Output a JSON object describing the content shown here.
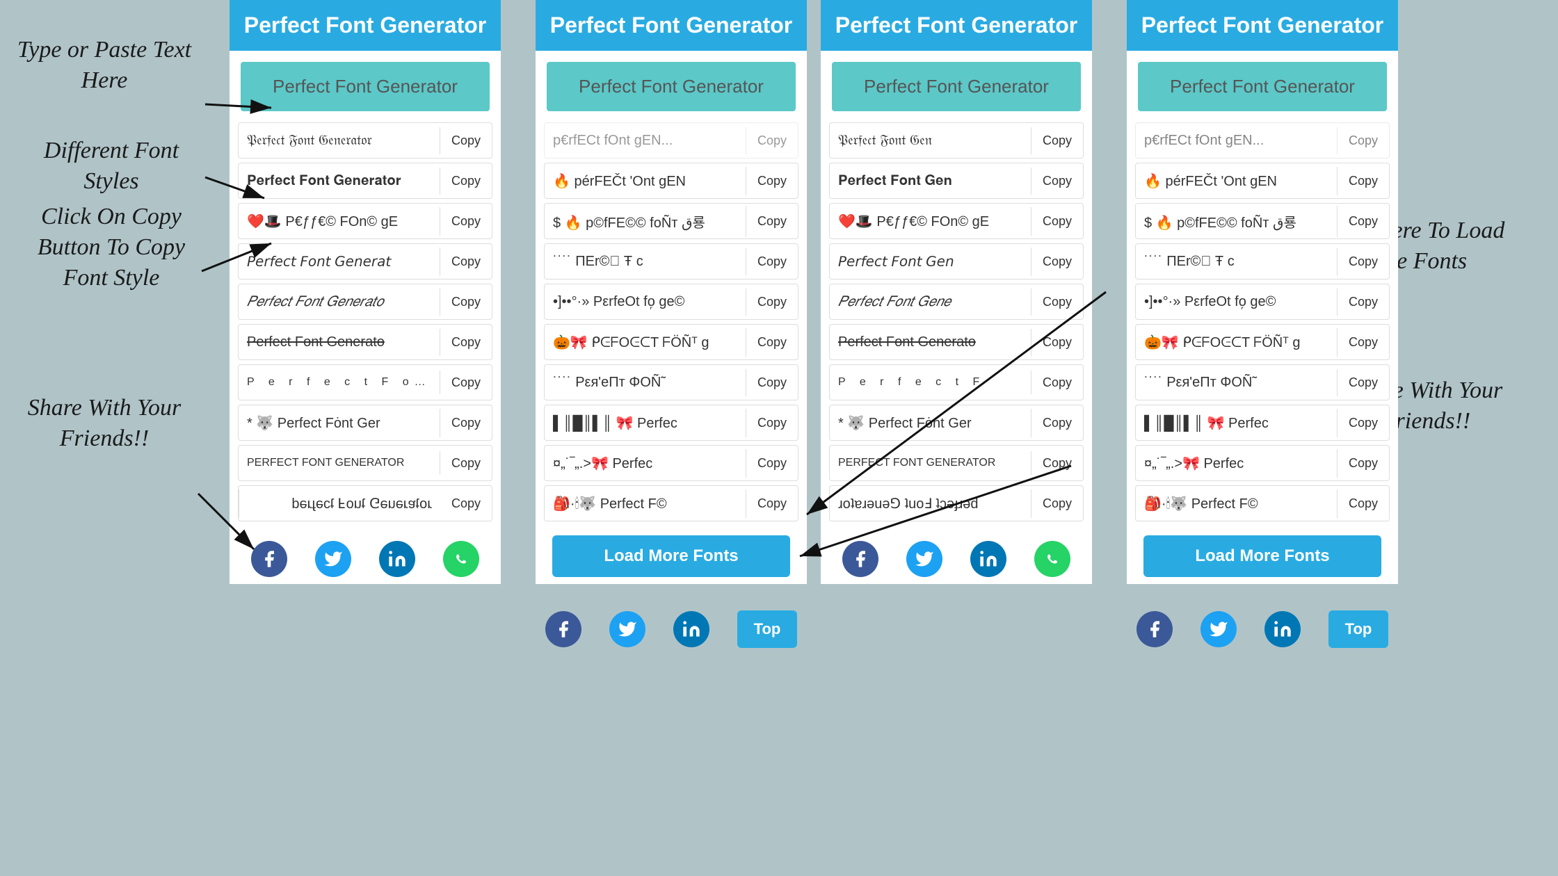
{
  "app": {
    "title": "Perfect Font Generator"
  },
  "annotations": {
    "type_paste": "Type or Paste Text Here",
    "diff_fonts": "Different Font Styles",
    "click_copy": "Click On Copy Button To Copy Font Style",
    "share": "Share With Your Friends!!",
    "load_more": "Click Here To Load More Fonts",
    "share2": "Share With Your Friends!!"
  },
  "input_placeholder": "Perfect Font Generator",
  "font_rows_left": [
    {
      "text": "𝔓𝔢𝔯𝔣𝔢𝔠𝔱 𝔉𝔬𝔫𝔱 𝔊𝔢𝔫𝔢𝔯𝔞𝔱𝔬𝔯",
      "style": "fraktur",
      "copy": "Copy"
    },
    {
      "text": "𝐏𝐞𝐫𝐟𝐞𝐜𝐭 𝐅𝐨𝐧𝐭 𝐆𝐞𝐧𝐞𝐫𝐚𝐭𝐨𝐫",
      "style": "bold",
      "copy": "Copy"
    },
    {
      "text": "❤️🎩 P€ƒƒ€© FOn© gE",
      "style": "emoji",
      "copy": "Copy"
    },
    {
      "text": "𝘗𝘦𝘳𝘧𝘦𝘤𝘵 𝘍𝘰𝘯𝘵 𝘎𝘦𝘯𝘦𝘳𝘢𝘵",
      "style": "italic",
      "copy": "Copy"
    },
    {
      "text": "𝑃𝑒𝑟𝑓𝑒𝑐𝑡 𝐹𝑜𝑛𝑡 𝐺𝑒𝑛𝑒𝑟𝑎𝑡𝑜",
      "style": "calligraphy",
      "copy": "Copy"
    },
    {
      "text": "Perfect Font Generator",
      "style": "strikethrough",
      "copy": "Copy"
    },
    {
      "text": "P e r f e c t  F o n t",
      "style": "spaced",
      "copy": "Copy"
    },
    {
      "text": "* 🐺 Perfect Fȯnt Ger",
      "style": "mixed",
      "copy": "Copy"
    },
    {
      "text": "PERFECT FONT GENERATOR",
      "style": "caps",
      "copy": "Copy"
    },
    {
      "text": "ɹoʇɐɹǝuǝ⅁ ʇuoℲ ʇɔǝɟɹǝd",
      "style": "flip",
      "copy": "Copy"
    }
  ],
  "font_rows_right": [
    {
      "text": "p€rfECt fOnt gEN",
      "style": "mixed1",
      "copy": "Copy"
    },
    {
      "text": "$ 🔥 p©fFE©© foÑτ ق룡",
      "style": "mixed2",
      "copy": "Copy"
    },
    {
      "text": "⁺ ˙˙ ⁺ ΠΕr©᷊ᷮᷪ Ŧ c",
      "style": "mixed3",
      "copy": "Copy"
    },
    {
      "text": "•]••°·.•»» PεrfeOt fo᷊ ge©",
      "style": "mixed4",
      "copy": "Copy"
    },
    {
      "text": "🎃🎀 ᑭᕮᖴOᕮᑕT ᖴÖÑᵀ g",
      "style": "mixed5",
      "copy": "Copy"
    },
    {
      "text": "˙˙˙˙˙ Pεя'eΠт ΦOÑ˜",
      "style": "mixed6",
      "copy": "Copy"
    },
    {
      "text": "▌║█ 🎀 Perfec",
      "style": "barcode",
      "copy": "Copy"
    },
    {
      "text": "¤„•˙‾„.•..>> 🎀 Perfec",
      "style": "mixed7",
      "copy": "Copy"
    },
    {
      "text": "🎒 · 🕯 🐺 Perfect F©",
      "style": "mixed8",
      "copy": "Copy"
    }
  ],
  "buttons": {
    "load_more": "Load More Fonts",
    "top": "Top",
    "copy": "Copy"
  },
  "social": {
    "facebook": "f",
    "twitter": "t",
    "linkedin": "in",
    "whatsapp": "w"
  }
}
